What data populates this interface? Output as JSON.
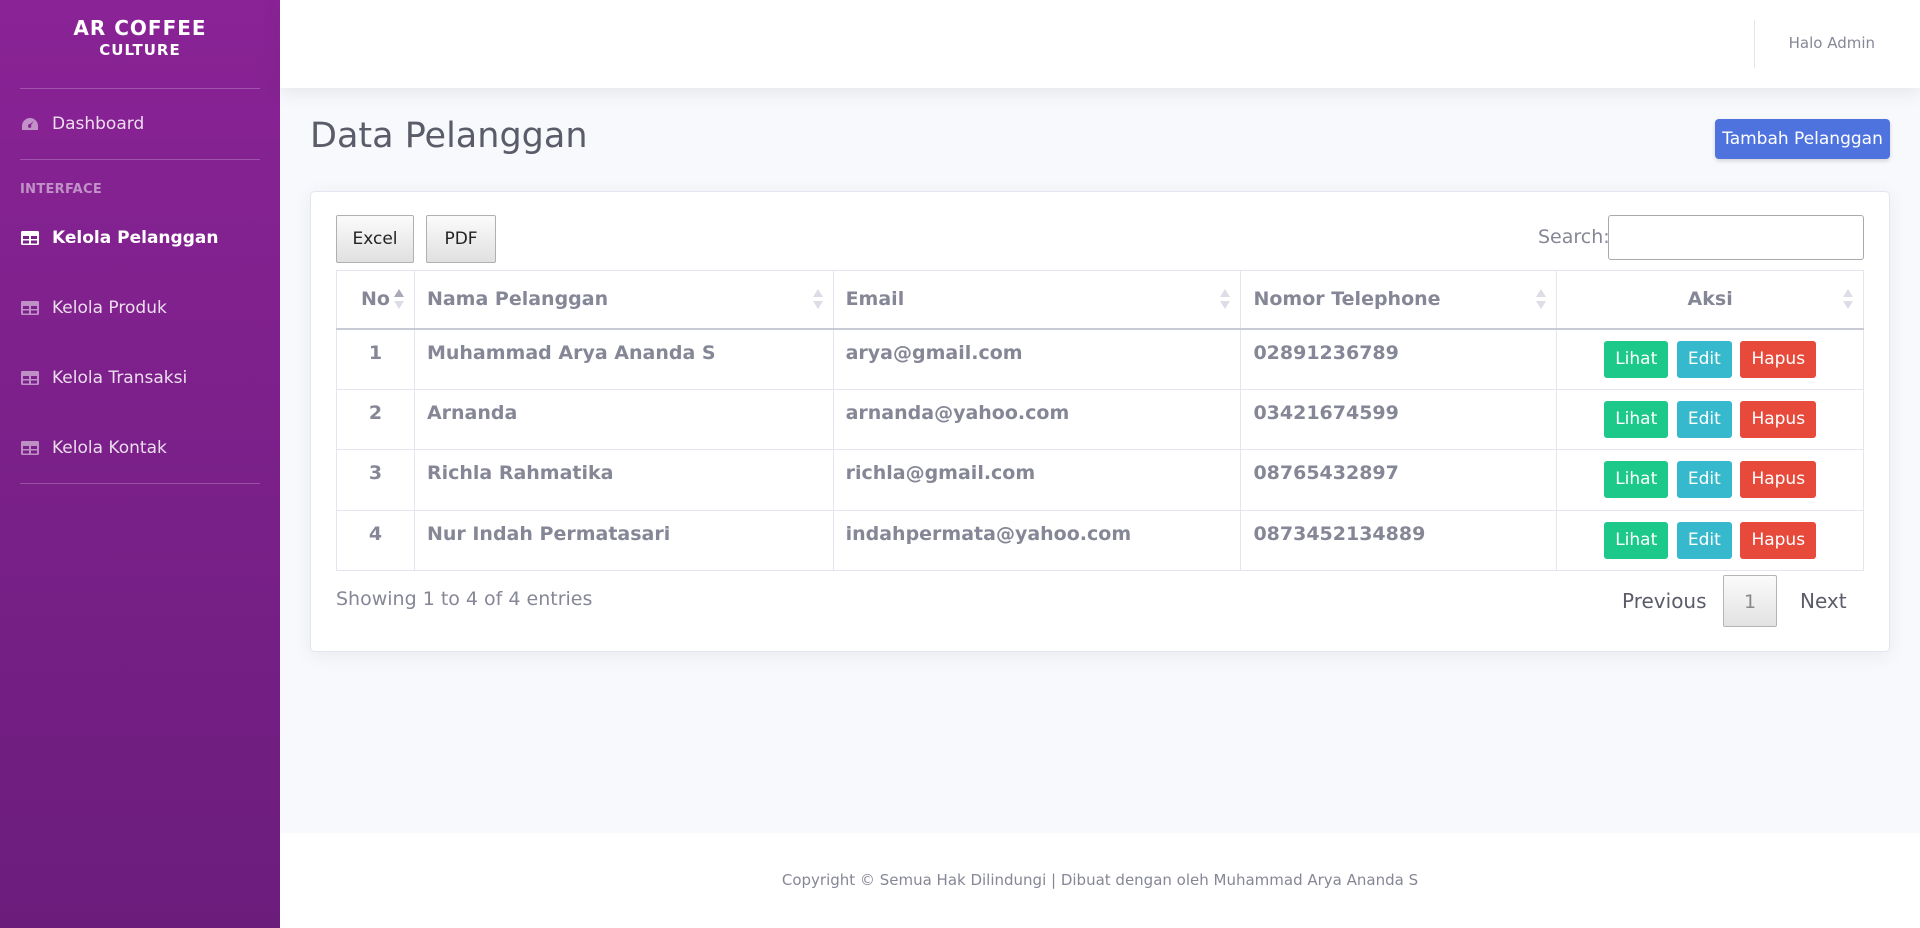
{
  "brand": {
    "line1": "AR COFFEE",
    "line2": "CULTURE"
  },
  "sidebar": {
    "dashboard": "Dashboard",
    "heading": "INTERFACE",
    "items": [
      {
        "label": "Kelola Pelanggan",
        "active": true
      },
      {
        "label": "Kelola Produk",
        "active": false
      },
      {
        "label": "Kelola Transaksi",
        "active": false
      },
      {
        "label": "Kelola Kontak",
        "active": false
      }
    ]
  },
  "topbar": {
    "user": "Halo Admin"
  },
  "page": {
    "title": "Data Pelanggan",
    "add_button": "Tambah Pelanggan"
  },
  "toolbar": {
    "excel": "Excel",
    "pdf": "PDF",
    "search_label": "Search:",
    "search_value": ""
  },
  "table": {
    "headers": [
      "No",
      "Nama Pelanggan",
      "Email",
      "Nomor Telephone",
      "Aksi"
    ],
    "rows": [
      {
        "no": "1",
        "nama": "Muhammad Arya Ananda S",
        "email": "arya@gmail.com",
        "telp": "02891236789"
      },
      {
        "no": "2",
        "nama": "Arnanda",
        "email": "arnanda@yahoo.com",
        "telp": "03421674599"
      },
      {
        "no": "3",
        "nama": "Richla Rahmatika",
        "email": "richla@gmail.com",
        "telp": "08765432897"
      },
      {
        "no": "4",
        "nama": "Nur Indah Permatasari",
        "email": "indahpermata@yahoo.com",
        "telp": "0873452134889"
      }
    ],
    "actions": {
      "view": "Lihat",
      "edit": "Edit",
      "delete": "Hapus"
    }
  },
  "pagination": {
    "info": "Showing 1 to 4 of 4 entries",
    "previous": "Previous",
    "current": "1",
    "next": "Next"
  },
  "footer": {
    "text": "Copyright © Semua Hak Dilindungi | Dibuat dengan oleh Muhammad Arya Ananda S"
  },
  "colors": {
    "sidebar": "#8a2396",
    "primary": "#4e73df",
    "success": "#1cc88a",
    "info": "#36b9cc",
    "danger": "#e74a3b"
  }
}
